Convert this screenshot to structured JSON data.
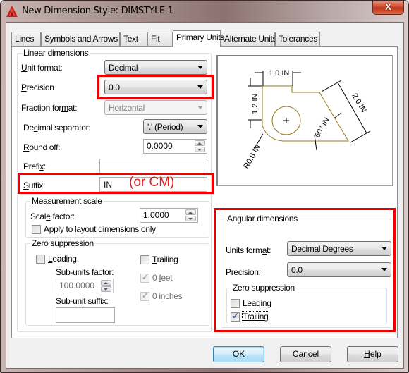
{
  "window": {
    "title": "New Dimension Style: DIMSTYLE 1",
    "close_glyph": "X"
  },
  "tabs": [
    {
      "label": "Lines",
      "active": false
    },
    {
      "label": "Symbols and Arrows",
      "active": false
    },
    {
      "label": "Text",
      "active": false
    },
    {
      "label": "Fit",
      "active": false
    },
    {
      "label": "Primary Units",
      "active": true
    },
    {
      "label": "Alternate Units",
      "active": false
    },
    {
      "label": "Tolerances",
      "active": false
    }
  ],
  "linear": {
    "group_label": "Linear dimensions",
    "unit_format_label": "Unit format:",
    "unit_format_value": "Decimal",
    "precision_label": "Precision",
    "precision_value": "0.0",
    "fraction_format_label": "Fraction format:",
    "fraction_format_value": "Horizontal",
    "decimal_separator_label": "Decimal separator:",
    "decimal_separator_value": "'.' (Period)",
    "round_off_label": "Round off:",
    "round_off_value": "0.0000",
    "prefix_label": "Prefix:",
    "prefix_value": "",
    "suffix_label": "Suffix:",
    "suffix_value": "IN",
    "suffix_annotation": "(or CM)"
  },
  "measurement_scale": {
    "group_label": "Measurement scale",
    "scale_factor_label": "Scale factor:",
    "scale_factor_value": "1.0000",
    "apply_layout_label": "Apply to layout dimensions only",
    "apply_layout_checked": false
  },
  "zero_suppression_linear": {
    "group_label": "Zero suppression",
    "leading_label": "Leading",
    "leading_checked": false,
    "trailing_label": "Trailing",
    "trailing_checked": false,
    "sub_units_factor_label": "Sub-units factor:",
    "sub_units_factor_value": "100.0000",
    "sub_unit_suffix_label": "Sub-unit suffix:",
    "sub_unit_suffix_value": "",
    "zero_feet_label": "0 feet",
    "zero_feet_checked": true,
    "zero_inches_label": "0 inches",
    "zero_inches_checked": true
  },
  "preview": {
    "dim_top": "1.0  IN",
    "dim_left": "1.2  IN",
    "dim_right": "2.0  IN",
    "dim_angle": "60°  IN",
    "dim_radius": "R0.8  IN"
  },
  "angular": {
    "group_label": "Angular dimensions",
    "units_format_label": "Units format:",
    "units_format_value": "Decimal Degrees",
    "precision_label": "Precision:",
    "precision_value": "0.0",
    "zero_suppression_label": "Zero suppression",
    "leading_label": "Leading",
    "leading_checked": false,
    "trailing_label": "Trailing",
    "trailing_checked": true
  },
  "buttons": {
    "ok": "OK",
    "cancel": "Cancel",
    "help": "Help"
  },
  "colors": {
    "highlight_red": "#ee0000",
    "preview_outline": "#9a7a1a"
  }
}
